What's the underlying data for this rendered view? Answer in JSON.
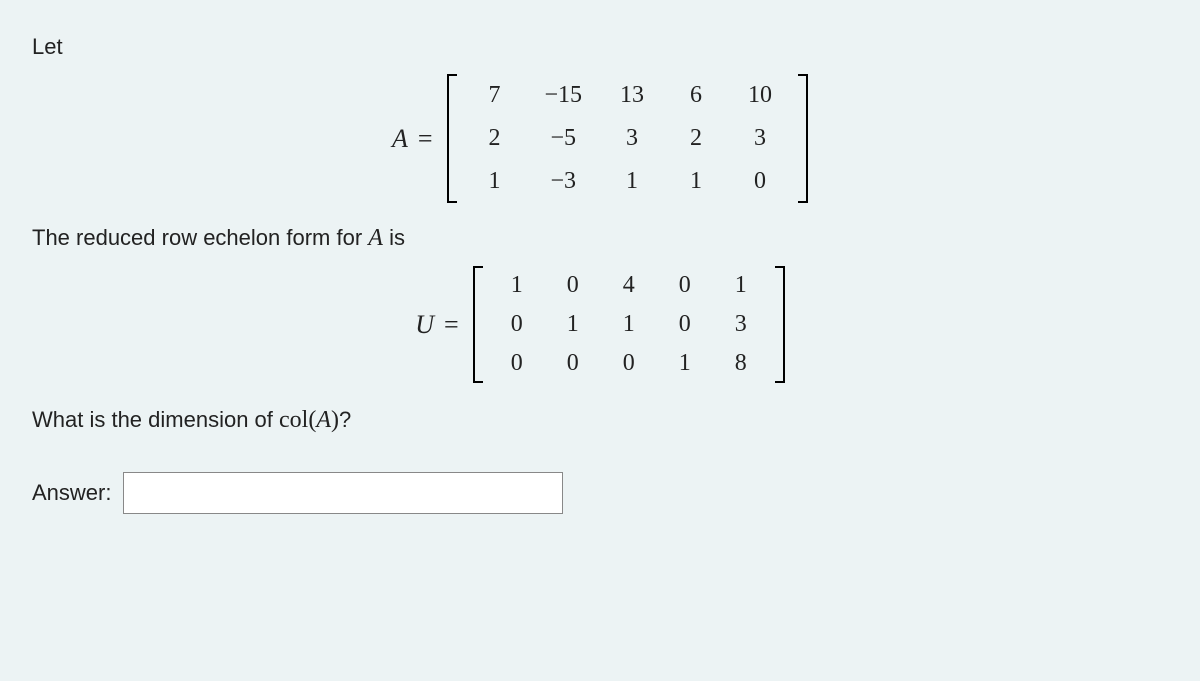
{
  "intro": "Let",
  "labelA": "A",
  "labelU": "U",
  "eq": "=",
  "matrixA": {
    "rows": [
      [
        "7",
        "−15",
        "13",
        "6",
        "10"
      ],
      [
        "2",
        "−5",
        "3",
        "2",
        "3"
      ],
      [
        "1",
        "−3",
        "1",
        "1",
        "0"
      ]
    ]
  },
  "rrefText": {
    "prefix": "The reduced row echelon form for ",
    "var": "A",
    "suffix": " is"
  },
  "matrixU": {
    "rows": [
      [
        "1",
        "0",
        "4",
        "0",
        "1"
      ],
      [
        "0",
        "1",
        "1",
        "0",
        "3"
      ],
      [
        "0",
        "0",
        "0",
        "1",
        "8"
      ]
    ]
  },
  "question": {
    "prefix": "What is the dimension of ",
    "func": "col(",
    "var": "A",
    "close": ")",
    "suffix": "?"
  },
  "answerLabel": "Answer:",
  "answerValue": "",
  "chart_data": {
    "type": "table",
    "title": "Matrices A and its RREF U",
    "matrices": {
      "A": [
        [
          7,
          -15,
          13,
          6,
          10
        ],
        [
          2,
          -5,
          3,
          2,
          3
        ],
        [
          1,
          -3,
          1,
          1,
          0
        ]
      ],
      "U": [
        [
          1,
          0,
          4,
          0,
          1
        ],
        [
          0,
          1,
          1,
          0,
          3
        ],
        [
          0,
          0,
          0,
          1,
          8
        ]
      ]
    }
  }
}
